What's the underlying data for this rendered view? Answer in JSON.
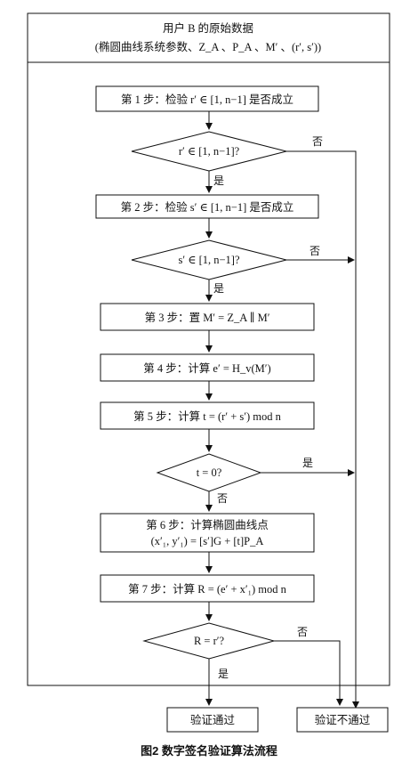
{
  "header": {
    "line1": "用户 B 的原始数据",
    "line2": "(椭圆曲线系统参数、Z_A 、P_A 、M′ 、(r′, s′))"
  },
  "steps": {
    "step1": "第 1 步：检验 r′ ∈ [1, n−1] 是否成立",
    "dec1": "r′ ∈ [1, n−1]?",
    "step2": "第 2 步：检验 s′ ∈ [1, n−1] 是否成立",
    "dec2": "s′ ∈ [1, n−1]?",
    "step3": "第 3 步：置 M′ = Z_A ∥ M′",
    "step4": "第 4 步：计算 e′ = H_v(M′)",
    "step5": "第 5 步：计算 t = (r′ + s′) mod n",
    "dec3": "t = 0?",
    "step6_line1": "第 6 步：计算椭圆曲线点",
    "step6_line2": "(x′₁, y′₁) = [s′]G + [t]P_A",
    "step7": "第 7 步：计算 R = (e′ + x′₁) mod n",
    "dec4": "R = r′?"
  },
  "edges": {
    "yes": "是",
    "no": "否"
  },
  "results": {
    "pass": "验证通过",
    "fail": "验证不通过"
  },
  "caption": "图2   数字签名验证算法流程"
}
